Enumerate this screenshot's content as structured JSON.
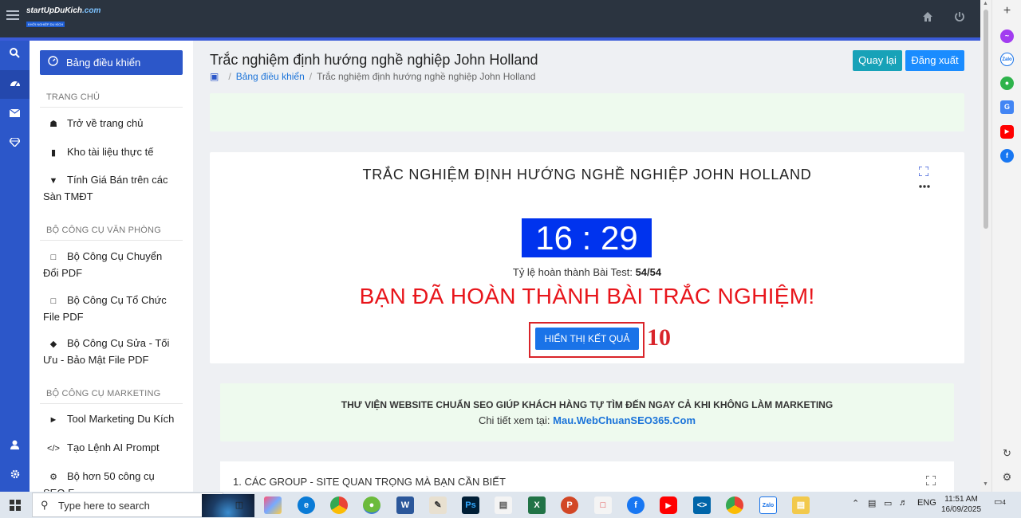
{
  "header": {
    "logo_text": "startUpDuKich",
    "logo_suffix": ".com",
    "logo_tagline": "KHỞI NGHIỆP DU KÍCH"
  },
  "sidebar": {
    "active_item": "Bảng điều khiển",
    "sections": [
      {
        "title": "TRANG CHỦ",
        "items": [
          "Trở về trang chủ",
          "Kho tài liệu thực tế",
          "Tính Giá Bán trên các Sàn TMĐT"
        ]
      },
      {
        "title": "BỘ CÔNG CỤ VĂN PHÒNG",
        "items": [
          "Bộ Công Cụ Chuyển Đổi PDF",
          "Bộ Công Cụ Tổ Chức File PDF",
          "Bộ Công Cụ Sửa - Tối Ưu - Bảo Mật File PDF"
        ]
      },
      {
        "title": "BỘ CÔNG CỤ MARKETING",
        "items": [
          "Tool Marketing Du Kích",
          "Tạo Lệnh AI Prompt",
          "Bộ hơn 50 công cụ SEO F..."
        ]
      }
    ]
  },
  "page": {
    "title": "Trắc nghiệm định hướng nghề nghiệp John Holland",
    "breadcrumb": [
      "Bảng điều khiển",
      "Trắc nghiệm định hướng nghề nghiệp John Holland"
    ],
    "back_button": "Quay lại",
    "logout_button": "Đăng xuất"
  },
  "quiz": {
    "title": "TRẮC NGHIỆM ĐỊNH HƯỚNG NGHỀ NGHIỆP JOHN HOLLAND",
    "timer": "16 : 29",
    "progress_label": "Tỷ lệ hoàn thành Bài Test:",
    "progress_value": "54/54",
    "completion_message": "BẠN ĐÃ HOÀN THÀNH BÀI TRẮC NGHIỆM!",
    "result_button": "HIỂN THỊ KẾT QUẢ",
    "annotation_number": "10"
  },
  "promo": {
    "title": "THƯ VIỆN WEBSITE CHUẨN SEO GIÚP KHÁCH HÀNG TỰ TÌM ĐẾN NGAY CẢ KHI KHÔNG LÀM MARKETING",
    "detail_label": "Chi tiết xem tại:",
    "link": "Mau.WebChuanSEO365.Com"
  },
  "section2": {
    "title": "1. CÁC GROUP - SITE QUAN TRỌNG MÀ BẠN CẦN BIẾT"
  },
  "taskbar": {
    "search_placeholder": "Type here to search",
    "language": "ENG",
    "time": "11:51 AM",
    "date": "16/09/2025",
    "notification_count": "4"
  },
  "colors": {
    "accent": "#2c57c9",
    "timer_bg": "#0033ee",
    "completion_text": "#e8151b",
    "annotation": "#d9242a"
  }
}
